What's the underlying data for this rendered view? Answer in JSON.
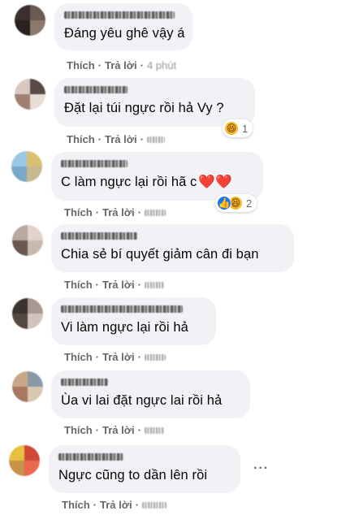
{
  "actions": {
    "like_label": "Thích",
    "reply_label": "Trả lời",
    "separator": "·"
  },
  "comments": [
    {
      "text": "Đáng yêu ghê vậy á",
      "time": "4 phút"
    },
    {
      "text": "Đặt lại túi ngực rồi hả Vy ?",
      "reaction_count": "1",
      "reaction_icon": "haha-reaction-icon"
    },
    {
      "text": "C làm ngực lại rồi hã c",
      "hearts": "❤️❤️",
      "reaction_count": "2",
      "reaction_icons": [
        "like-reaction-icon",
        "haha-reaction-icon"
      ]
    },
    {
      "text": "Chia sẻ bí quyết giảm cân đi bạn"
    },
    {
      "text": "Vi làm ngực lại rồi hả"
    },
    {
      "text": "Ùa vi lai đặt ngực lai rồi hả"
    },
    {
      "text": "Ngực cũng to dần lên rồi",
      "more_label": "···"
    }
  ],
  "colors": {
    "bubble": "#f0f2f5",
    "action_text": "#65676b",
    "like_blue": "#1877f2",
    "haha_yellow": "#f7b928",
    "heart_red": "#e41e3f"
  }
}
